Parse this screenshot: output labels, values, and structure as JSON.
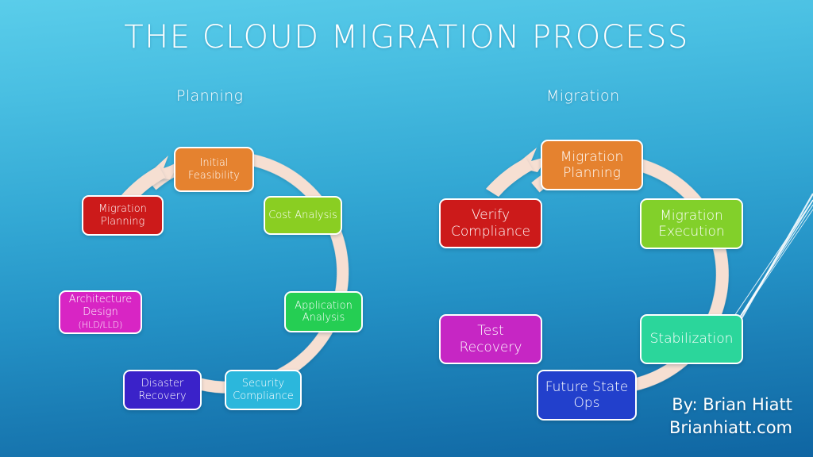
{
  "slide": {
    "title": "THE CLOUD MIGRATION PROCESS",
    "background_top_color": "#5ACDEA",
    "background_bottom_color": "#0F65A2",
    "ring_color": "#F6DFD2",
    "arrow_color": "#F6DFD2"
  },
  "sections": {
    "left_label": "Planning",
    "right_label": "Migration"
  },
  "planning_cycle": {
    "label": "Planning",
    "nodes": [
      {
        "label": "Initial\nFeasibility",
        "color": "#E5822F",
        "position": "top"
      },
      {
        "label": "Cost Analysis",
        "color": "#8ACE22",
        "position": "upper-right"
      },
      {
        "label": "Application\nAnalysis",
        "color": "#25CE53",
        "position": "lower-right"
      },
      {
        "label": "Security\nCompliance",
        "color": "#2BB7DC",
        "position": "bottom-right"
      },
      {
        "label": "Disaster\nRecovery",
        "color": "#3A22C9",
        "position": "bottom-left"
      },
      {
        "label": "Architecture\nDesign",
        "sub": "(HLD/LLD)",
        "color": "#D825C4",
        "position": "lower-left"
      },
      {
        "label": "Migration\nPlanning",
        "color": "#CC1A1A",
        "position": "upper-left"
      }
    ]
  },
  "migration_cycle": {
    "label": "Migration",
    "nodes": [
      {
        "label": "Migration\nPlanning",
        "color": "#E5822F",
        "position": "top"
      },
      {
        "label": "Migration\nExecution",
        "color": "#82D02A",
        "position": "upper-right"
      },
      {
        "label": "Stabilization",
        "color": "#2BD69B",
        "position": "lower-right"
      },
      {
        "label": "Future State\nOps",
        "color": "#2240CC",
        "position": "bottom"
      },
      {
        "label": "Test\nRecovery",
        "color": "#C626C4",
        "position": "lower-left"
      },
      {
        "label": "Verify\nCompliance",
        "color": "#CC1A1A",
        "position": "upper-left"
      }
    ]
  },
  "credit": {
    "line1": "By: Brian Hiatt",
    "line2": "Brianhiatt.com"
  }
}
